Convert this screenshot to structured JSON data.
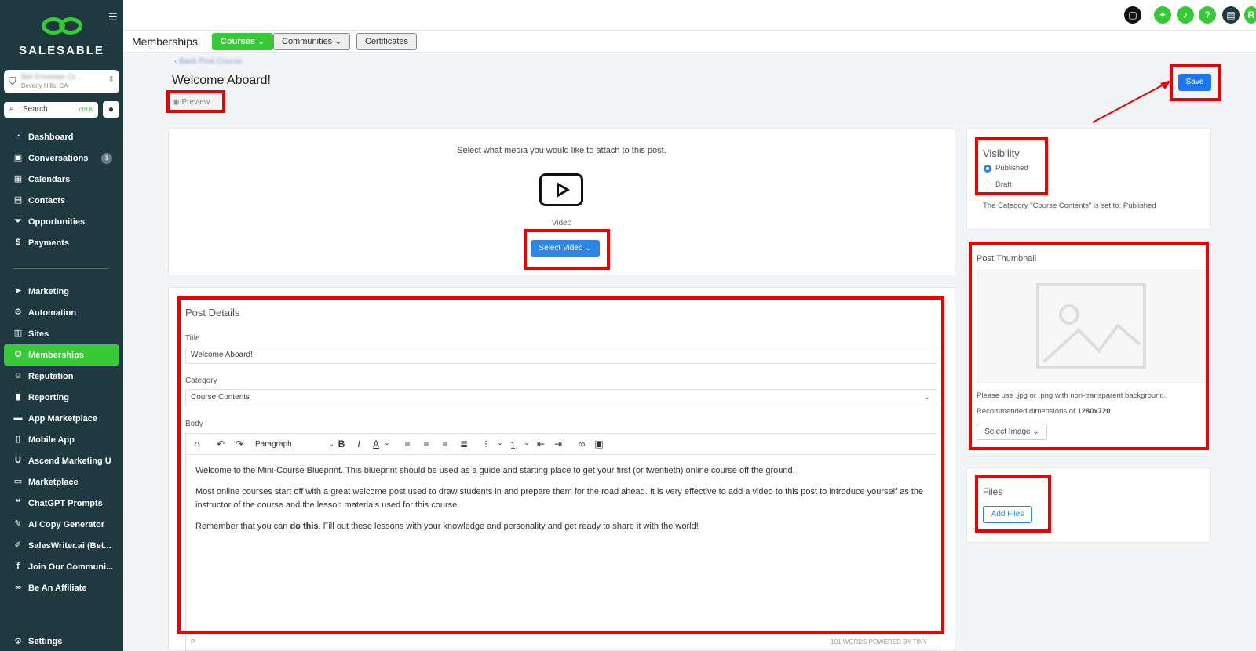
{
  "brand": {
    "name": "SALESABLE"
  },
  "sidebar": {
    "location_name": "Bel Ennistan Cr...",
    "location_sub": "Beverly Hills, CA",
    "search_label": "Search",
    "search_shortcut": "ctrl K",
    "conversations_badge": "1",
    "items": [
      {
        "label": "Dashboard",
        "icon": "dashboard-icon"
      },
      {
        "label": "Conversations",
        "icon": "chat-icon"
      },
      {
        "label": "Calendars",
        "icon": "calendar-icon"
      },
      {
        "label": "Contacts",
        "icon": "contact-card-icon"
      },
      {
        "label": "Opportunities",
        "icon": "funnel-icon"
      },
      {
        "label": "Payments",
        "icon": "payments-icon"
      }
    ],
    "items2": [
      {
        "label": "Marketing",
        "icon": "send-icon"
      },
      {
        "label": "Automation",
        "icon": "automation-icon"
      },
      {
        "label": "Sites",
        "icon": "sites-icon"
      },
      {
        "label": "Memberships",
        "icon": "membership-icon"
      },
      {
        "label": "Reputation",
        "icon": "smile-icon"
      },
      {
        "label": "Reporting",
        "icon": "bar-chart-icon"
      },
      {
        "label": "App Marketplace",
        "icon": "briefcase-icon"
      },
      {
        "label": "Mobile App",
        "icon": "phone-icon"
      },
      {
        "label": "Ascend Marketing U",
        "icon": "u-icon"
      },
      {
        "label": "Marketplace",
        "icon": "store-icon"
      },
      {
        "label": "ChatGPT Prompts",
        "icon": "quote-icon"
      },
      {
        "label": "AI Copy Generator",
        "icon": "edit-icon"
      },
      {
        "label": "SalesWriter.ai (Bet...",
        "icon": "pen-icon"
      },
      {
        "label": "Join Our Communi...",
        "icon": "facebook-icon"
      },
      {
        "label": "Be An Affiliate",
        "icon": "link-icon"
      }
    ],
    "settings_label": "Settings"
  },
  "subnav": {
    "title": "Memberships",
    "tabs": [
      {
        "label": "Courses",
        "active": true
      },
      {
        "label": "Communities",
        "active": false
      },
      {
        "label": "Certificates",
        "active": false
      }
    ]
  },
  "page": {
    "breadcrumb": "Back Post Course",
    "title": "Welcome Aboard!",
    "preview_label": "Preview",
    "save_label": "Save"
  },
  "media": {
    "prompt": "Select what media you would like to attach to this post.",
    "video_label": "Video",
    "select_video_label": "Select Video"
  },
  "post_details": {
    "heading": "Post Details",
    "title_label": "Title",
    "title_value": "Welcome Aboard!",
    "category_label": "Category",
    "category_value": "Course Contents",
    "body_label": "Body",
    "block_format": "Paragraph",
    "body_paragraphs": [
      "Welcome to the Mini-Course Blueprint. This blueprint should be used as a guide and starting place to get your first (or twentieth) online course off the ground.",
      "Most online courses start off with a great welcome post used to draw students in and prepare them for the road ahead. It is very effective to add a video to this post to introduce yourself as the instructor of the course and the lesson materials used for this course."
    ],
    "body_p3_before": "Remember that you can ",
    "body_p3_bold": "do this",
    "body_p3_after": ". Fill out these lessons with your knowledge and personality and get ready to share it with the world!",
    "status_path": "P",
    "status_words": "101 WORDS  POWERED BY TINY"
  },
  "visibility": {
    "heading": "Visibility",
    "options": [
      "Published",
      "Draft"
    ],
    "selected": "Published",
    "note": "The Category \"Course Contents\" is set to: Published"
  },
  "thumbnail": {
    "heading": "Post Thumbnail",
    "hint1": "Please use .jpg or .png with non-transparent background.",
    "hint2_prefix": "Recommended dimensions of ",
    "hint2_bold": "1280x720",
    "select_label": "Select Image"
  },
  "files": {
    "heading": "Files",
    "add_label": "Add Files"
  },
  "colors": {
    "sidebar_bg": "#1e3a40",
    "accent_green": "#37ca37",
    "primary_blue": "#1877f2",
    "annotation_red": "#e00000"
  }
}
